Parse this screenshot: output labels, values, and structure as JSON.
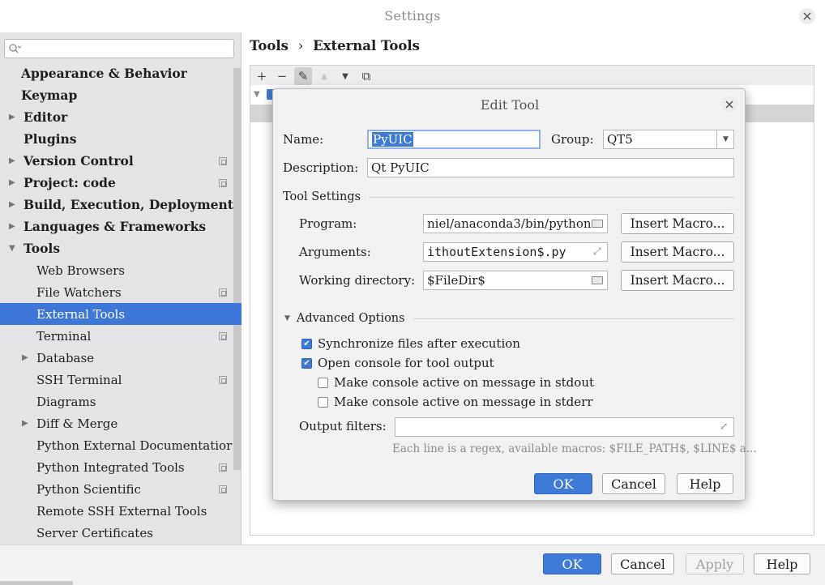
{
  "window": {
    "title": "Settings"
  },
  "search": {
    "placeholder": ""
  },
  "sidebar": {
    "items": [
      {
        "label": "Appearance & Behavior",
        "level": 0,
        "bold": true,
        "arrow": false,
        "icon": false,
        "selected": false
      },
      {
        "label": "Keymap",
        "level": 0,
        "bold": true,
        "arrow": false,
        "icon": false,
        "selected": false
      },
      {
        "label": "Editor",
        "level": 0,
        "bold": true,
        "arrow": "right",
        "icon": false,
        "selected": false
      },
      {
        "label": "Plugins",
        "level": 0,
        "bold": true,
        "arrow": false,
        "icon": false,
        "selected": false
      },
      {
        "label": "Version Control",
        "level": 0,
        "bold": true,
        "arrow": "right",
        "icon": true,
        "selected": false
      },
      {
        "label": "Project: code",
        "level": 0,
        "bold": true,
        "arrow": "right",
        "icon": true,
        "selected": false
      },
      {
        "label": "Build, Execution, Deployment",
        "level": 0,
        "bold": true,
        "arrow": "right",
        "icon": false,
        "selected": false
      },
      {
        "label": "Languages & Frameworks",
        "level": 0,
        "bold": true,
        "arrow": "right",
        "icon": false,
        "selected": false
      },
      {
        "label": "Tools",
        "level": 0,
        "bold": true,
        "arrow": "down",
        "icon": false,
        "selected": false
      },
      {
        "label": "Web Browsers",
        "level": 1,
        "bold": false,
        "arrow": false,
        "icon": false,
        "selected": false
      },
      {
        "label": "File Watchers",
        "level": 1,
        "bold": false,
        "arrow": false,
        "icon": true,
        "selected": false
      },
      {
        "label": "External Tools",
        "level": 1,
        "bold": false,
        "arrow": false,
        "icon": false,
        "selected": true
      },
      {
        "label": "Terminal",
        "level": 1,
        "bold": false,
        "arrow": false,
        "icon": true,
        "selected": false
      },
      {
        "label": "Database",
        "level": 1,
        "bold": false,
        "arrow": "right",
        "icon": false,
        "selected": false
      },
      {
        "label": "SSH Terminal",
        "level": 1,
        "bold": false,
        "arrow": false,
        "icon": true,
        "selected": false
      },
      {
        "label": "Diagrams",
        "level": 1,
        "bold": false,
        "arrow": false,
        "icon": false,
        "selected": false
      },
      {
        "label": "Diff & Merge",
        "level": 1,
        "bold": false,
        "arrow": "right",
        "icon": false,
        "selected": false
      },
      {
        "label": "Python External Documentatior",
        "level": 1,
        "bold": false,
        "arrow": false,
        "icon": false,
        "selected": false
      },
      {
        "label": "Python Integrated Tools",
        "level": 1,
        "bold": false,
        "arrow": false,
        "icon": true,
        "selected": false
      },
      {
        "label": "Python Scientific",
        "level": 1,
        "bold": false,
        "arrow": false,
        "icon": true,
        "selected": false
      },
      {
        "label": "Remote SSH External Tools",
        "level": 1,
        "bold": false,
        "arrow": false,
        "icon": false,
        "selected": false
      },
      {
        "label": "Server Certificates",
        "level": 1,
        "bold": false,
        "arrow": false,
        "icon": false,
        "selected": false
      }
    ]
  },
  "breadcrumb": {
    "parent": "Tools",
    "separator": "›",
    "current": "External Tools"
  },
  "toolbar": {
    "add": "+",
    "remove": "−",
    "edit": "✎",
    "up": "▲",
    "down": "▼",
    "copy": "⧉"
  },
  "dialog": {
    "title": "Edit Tool",
    "name_label": "Name:",
    "name_value": "PyUIC",
    "group_label": "Group:",
    "group_value": "QT5",
    "description_label": "Description:",
    "description_value": "Qt PyUIC",
    "tool_settings_label": "Tool Settings",
    "program_label": "Program:",
    "program_value": "niel/anaconda3/bin/python",
    "arguments_label": "Arguments:",
    "arguments_value": "ithoutExtension$.py",
    "workdir_label": "Working directory:",
    "workdir_value": "$FileDir$",
    "insert_macro": "Insert Macro...",
    "advanced_label": "Advanced Options",
    "sync_label": "Synchronize files after execution",
    "sync_checked": true,
    "console_label": "Open console for tool output",
    "console_checked": true,
    "stdout_label": "Make console active on message in stdout",
    "stdout_checked": false,
    "stderr_label": "Make console active on message in stderr",
    "stderr_checked": false,
    "output_filters_label": "Output filters:",
    "output_filters_value": "",
    "hint": "Each line is a regex, available macros: $FILE_PATH$, $LINE$ a...",
    "ok": "OK",
    "cancel": "Cancel",
    "help": "Help"
  },
  "footer": {
    "ok": "OK",
    "cancel": "Cancel",
    "apply": "Apply",
    "help": "Help"
  },
  "colors": {
    "accent": "#3d7bd6",
    "sidebar_bg": "#e4e4e7",
    "dialog_bg": "#f2f2f2"
  }
}
